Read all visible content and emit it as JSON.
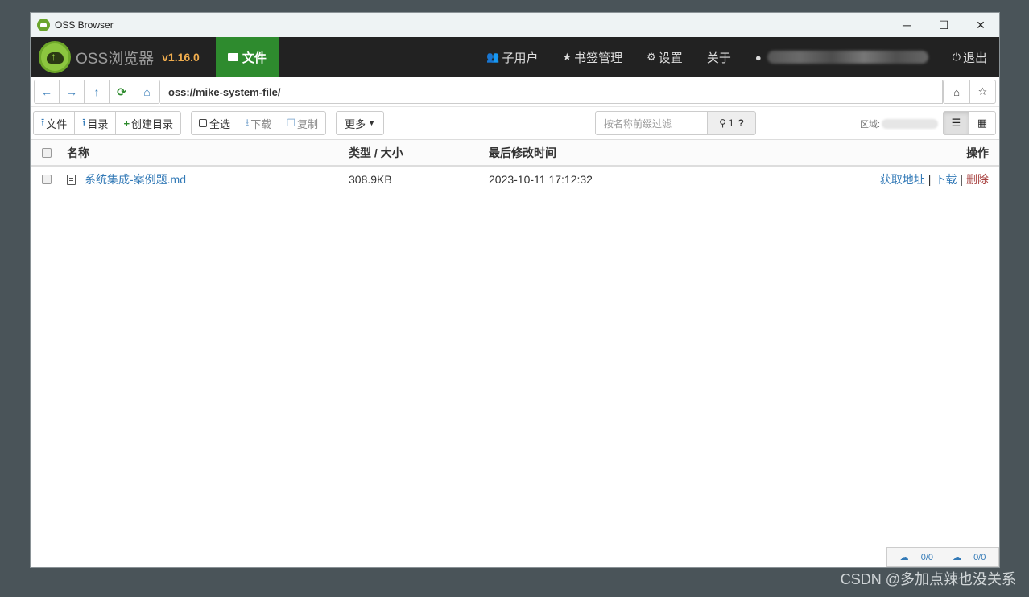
{
  "window": {
    "title": "OSS Browser",
    "controls": {
      "minimize": "─",
      "maximize": "☐",
      "close": "✕"
    }
  },
  "navbar": {
    "brand": "OSS浏览器",
    "version": "v1.16.0",
    "active_tab": "文件",
    "items": [
      {
        "label": "子用户",
        "icon": "users-icon",
        "glyph": "👥"
      },
      {
        "label": "书签管理",
        "icon": "star-icon",
        "glyph": "★"
      },
      {
        "label": "设置",
        "icon": "gear-icon",
        "glyph": "⚙"
      },
      {
        "label": "关于",
        "icon": "",
        "glyph": ""
      }
    ],
    "logout": "退出"
  },
  "address": {
    "path": "oss://mike-system-file/"
  },
  "toolbar": {
    "upload_file": "文件",
    "upload_dir": "目录",
    "create_dir": "创建目录",
    "select_all": "全选",
    "download": "下载",
    "copy": "复制",
    "more": "更多",
    "search_placeholder": "按名称前缀过滤",
    "result_count": "1",
    "region_label": "区域:"
  },
  "table": {
    "headers": {
      "name": "名称",
      "type_size": "类型 / 大小",
      "modified": "最后修改时间",
      "actions": "操作"
    },
    "rows": [
      {
        "name": "系统集成-案例题.md",
        "size": "308.9KB",
        "modified": "2023-10-11 17:12:32",
        "actions": {
          "get_url": "获取地址",
          "download": "下载",
          "delete": "删除"
        }
      }
    ]
  },
  "status": {
    "upload": "0/0",
    "download": "0/0"
  },
  "watermark": "CSDN @多加点辣也没关系",
  "colors": {
    "accent_green": "#2e8b2e",
    "link": "#337ab7",
    "danger": "#a94442",
    "version": "#f0ad4e"
  }
}
